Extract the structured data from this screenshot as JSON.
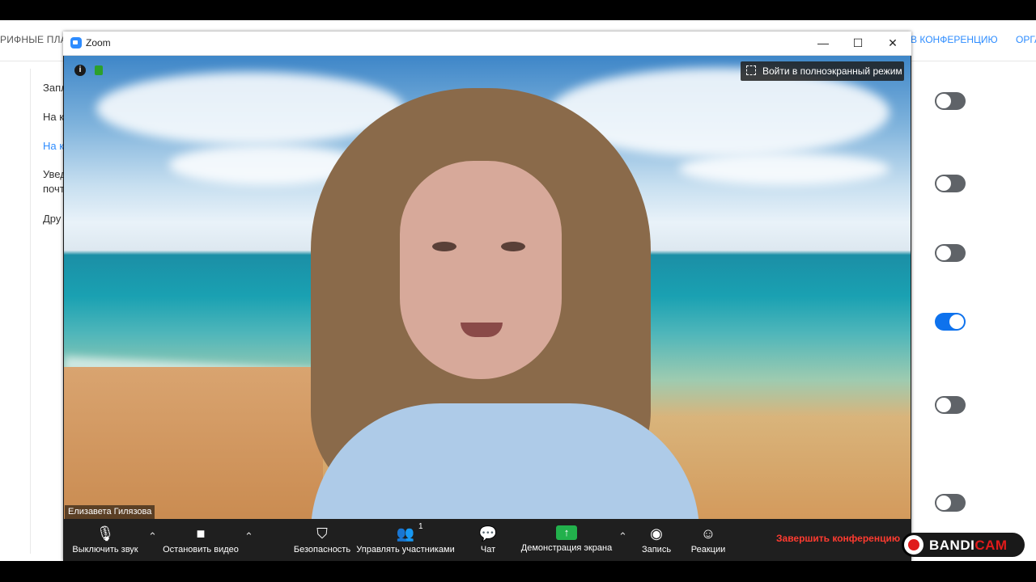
{
  "website": {
    "nav_left": "РИФНЫЕ ПЛАН",
    "nav_right1": "В КОНФЕРЕНЦИЮ",
    "nav_right2": "ОРГА",
    "settings_text": [
      "Запл",
      "На к",
      "На к",
      "Увед",
      "почт",
      "Дру"
    ],
    "toggles": [
      false,
      false,
      false,
      true,
      false,
      false
    ]
  },
  "zoom_window": {
    "title": "Zoom",
    "minimize": "—",
    "maximize": "☐",
    "close": "✕"
  },
  "video": {
    "fullscreen_label": "Войти в полноэкранный режим",
    "participant_name": "Елизавета Гилязова"
  },
  "toolbar": {
    "mute_label": "Выключить звук",
    "video_label": "Остановить видео",
    "security_label": "Безопасность",
    "participants_label": "Управлять участниками",
    "participants_count": "1",
    "chat_label": "Чат",
    "share_label": "Демонстрация экрана",
    "record_label": "Запись",
    "reactions_label": "Реакции",
    "end_label": "Завершить конференцию"
  },
  "bandicam": {
    "text_a": "BANDI",
    "text_b": "CAM"
  }
}
